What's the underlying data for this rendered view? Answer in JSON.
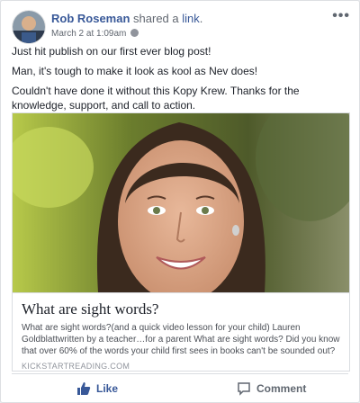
{
  "post": {
    "author": "Rob Roseman",
    "action_text": "shared a",
    "link_word": "link",
    "period": ".",
    "timestamp": "March 2 at 1:09am",
    "more_icon": "more-horizontal-icon",
    "paragraphs": [
      "Just hit publish on our first ever blog post!",
      "Man, it's tough to make it look as kool as Nev does!",
      "Couldn't have done it without this Kopy Krew. Thanks for the knowledge, support, and call to action."
    ]
  },
  "link_preview": {
    "title": "What are sight words?",
    "description": "What are sight words?(and a quick video lesson for your child) Lauren Goldblattwritten by a teacher…for a parent What are sight words? Did you know that over 60% of the words your child first sees in books can't be sounded out?Try…",
    "domain": "KICKSTARTREADING.COM"
  },
  "actions": {
    "like_label": "Like",
    "comment_label": "Comment"
  },
  "colors": {
    "link_blue": "#385898",
    "text": "#1d2129",
    "muted": "#606770"
  }
}
